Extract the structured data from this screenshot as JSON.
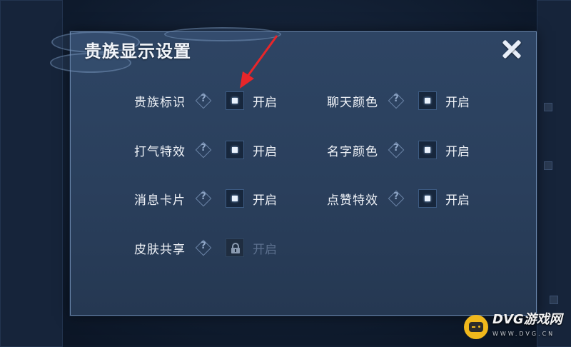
{
  "dialog": {
    "title": "贵族显示设置",
    "close_icon": "close-x-icon"
  },
  "settings": [
    {
      "label": "贵族标识",
      "state": "开启",
      "checked": true,
      "locked": false
    },
    {
      "label": "聊天颜色",
      "state": "开启",
      "checked": true,
      "locked": false
    },
    {
      "label": "打气特效",
      "state": "开启",
      "checked": true,
      "locked": false
    },
    {
      "label": "名字颜色",
      "state": "开启",
      "checked": true,
      "locked": false
    },
    {
      "label": "消息卡片",
      "state": "开启",
      "checked": true,
      "locked": false
    },
    {
      "label": "点赞特效",
      "state": "开启",
      "checked": true,
      "locked": false
    },
    {
      "label": "皮肤共享",
      "state": "开启",
      "checked": false,
      "locked": true
    }
  ],
  "help_icon": "question-diamond-icon",
  "help_glyph": "?",
  "annotation": {
    "icon": "red-arrow-icon",
    "color": "#e8262a"
  },
  "watermark": {
    "name": "DVG游戏网",
    "url": "WWW.DVG.CN"
  },
  "colors": {
    "accent": "#3d5b82",
    "dialog_bg": "#2a3f5c",
    "text": "#f0f3f8",
    "disabled_text": "#5c708e"
  }
}
